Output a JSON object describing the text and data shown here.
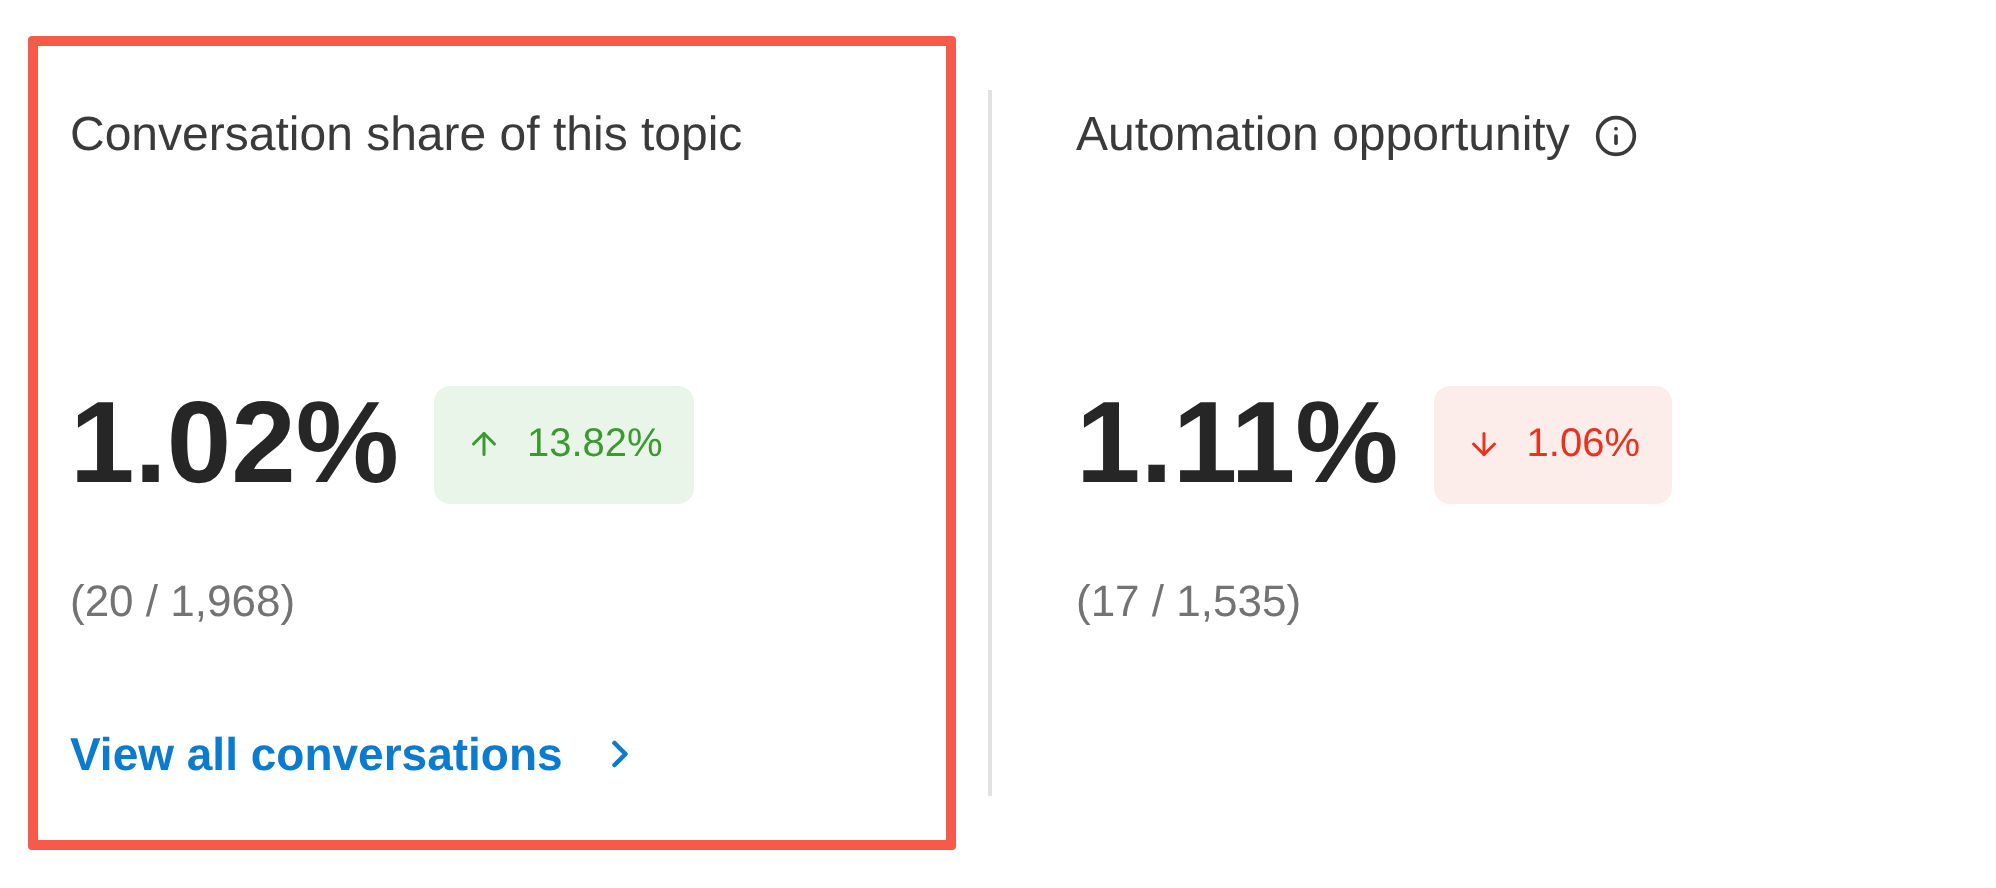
{
  "metrics": [
    {
      "title": "Conversation share of this topic",
      "info": false,
      "highlighted": true,
      "value": "1.02%",
      "change": {
        "kind": "rise",
        "text": "13.82%"
      },
      "ratio": "(20 / 1,968)",
      "link": "View all conversations"
    },
    {
      "title": "Automation opportunity",
      "info": true,
      "highlighted": false,
      "value": "1.11%",
      "change": {
        "kind": "fall",
        "text": "1.06%"
      },
      "ratio": "(17 / 1,535)"
    }
  ]
}
